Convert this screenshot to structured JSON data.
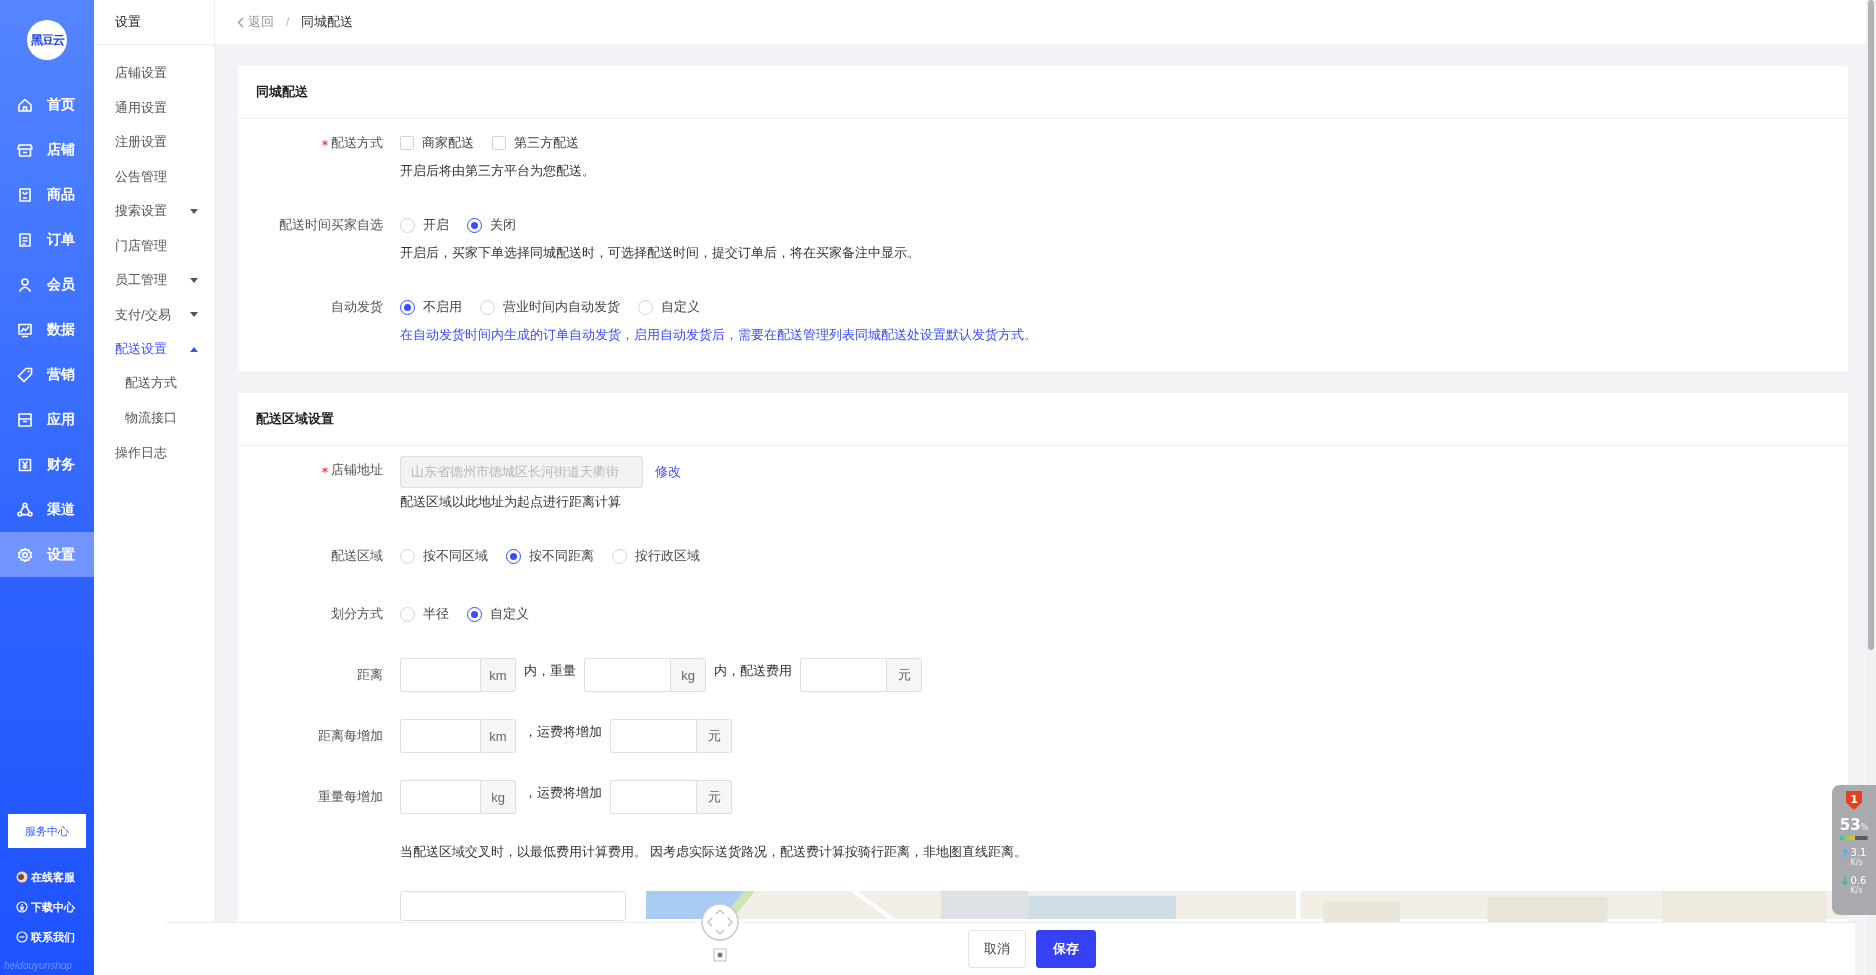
{
  "nav": {
    "logo": "黑豆云",
    "items": [
      {
        "label": "首页",
        "selected": false
      },
      {
        "label": "店铺",
        "selected": false
      },
      {
        "label": "商品",
        "selected": false
      },
      {
        "label": "订单",
        "selected": false
      },
      {
        "label": "会员",
        "selected": false
      },
      {
        "label": "数据",
        "selected": false
      },
      {
        "label": "营销",
        "selected": false
      },
      {
        "label": "应用",
        "selected": false
      },
      {
        "label": "财务",
        "selected": false
      },
      {
        "label": "渠道",
        "selected": false
      },
      {
        "label": "设置",
        "selected": true
      }
    ],
    "service_button": "服务中心",
    "links": [
      "在线客服",
      "下载中心",
      "联系我们"
    ],
    "footer": "heidouyunshop"
  },
  "subnav": {
    "title": "设置",
    "items": [
      {
        "kind": "link",
        "label": "店铺设置",
        "selected": false
      },
      {
        "kind": "link",
        "label": "通用设置",
        "selected": false
      },
      {
        "kind": "link",
        "label": "注册设置",
        "selected": false
      },
      {
        "kind": "link",
        "label": "公告管理",
        "selected": false
      },
      {
        "kind": "group",
        "label": "搜索设置",
        "selected": false,
        "expanded": false
      },
      {
        "kind": "link",
        "label": "门店管理",
        "selected": false
      },
      {
        "kind": "group",
        "label": "员工管理",
        "selected": false,
        "expanded": false
      },
      {
        "kind": "group",
        "label": "支付/交易",
        "selected": false,
        "expanded": false
      },
      {
        "kind": "group",
        "label": "配送设置",
        "selected": true,
        "expanded": true,
        "children": [
          {
            "label": "配送方式",
            "selected": false
          },
          {
            "label": "物流接口",
            "selected": false
          }
        ]
      },
      {
        "kind": "link",
        "label": "操作日志",
        "selected": false
      }
    ]
  },
  "breadcrumb": {
    "back": "返回",
    "separator": "/",
    "current": "同城配送"
  },
  "sections": [
    {
      "title": "同城配送",
      "fields": [
        {
          "kind": "checkboxes",
          "label": "配送方式",
          "required": true,
          "options": [
            {
              "label": "商家配送",
              "checked": false
            },
            {
              "label": "第三方配送",
              "checked": false
            }
          ],
          "hint": "开启后将由第三方平台为您配送。",
          "hint_accent": false
        },
        {
          "kind": "radios",
          "label": "配送时间买家自选",
          "required": false,
          "options": [
            {
              "label": "开启",
              "selected": false
            },
            {
              "label": "关闭",
              "selected": true
            }
          ],
          "hint": "开启后，买家下单选择同城配送时，可选择配送时间，提交订单后，将在买家备注中显示。",
          "hint_accent": false
        },
        {
          "kind": "radios",
          "label": "自动发货",
          "required": false,
          "options": [
            {
              "label": "不启用",
              "selected": true
            },
            {
              "label": "营业时间内自动发货",
              "selected": false
            },
            {
              "label": "自定义",
              "selected": false
            }
          ],
          "hint": "在自动发货时间内生成的订单自动发货，启用自动发货后，需要在配送管理列表同城配送处设置默认发货方式。",
          "hint_accent": true
        }
      ]
    },
    {
      "title": "配送区域设置",
      "fields": [
        {
          "kind": "address",
          "label": "店铺地址",
          "required": true,
          "value": "山东省德州市德城区长河街道天衢街",
          "disabled": true,
          "action": "修改",
          "hint": "配送区域以此地址为起点进行距离计算",
          "hint_accent": false
        },
        {
          "kind": "radios",
          "label": "配送区域",
          "required": false,
          "options": [
            {
              "label": "按不同区域",
              "selected": false
            },
            {
              "label": "按不同距离",
              "selected": true
            },
            {
              "label": "按行政区域",
              "selected": false
            }
          ]
        },
        {
          "kind": "radios",
          "label": "划分方式",
          "required": false,
          "options": [
            {
              "label": "半径",
              "selected": false
            },
            {
              "label": "自定义",
              "selected": true
            }
          ]
        },
        {
          "kind": "fee",
          "label": "距离",
          "required": false,
          "parts": [
            {
              "kind": "input",
              "unit": "km"
            },
            {
              "kind": "text",
              "text": "内，重量"
            },
            {
              "kind": "input",
              "unit": "kg"
            },
            {
              "kind": "text",
              "text": "内，配送费用"
            },
            {
              "kind": "input",
              "unit": "元"
            }
          ]
        },
        {
          "kind": "fee",
          "label": "距离每增加",
          "required": false,
          "parts": [
            {
              "kind": "input",
              "unit": "km"
            },
            {
              "kind": "text",
              "text": "，运费将增加"
            },
            {
              "kind": "input",
              "unit": "元"
            }
          ]
        },
        {
          "kind": "fee",
          "label": "重量每增加",
          "required": false,
          "parts": [
            {
              "kind": "input",
              "unit": "kg"
            },
            {
              "kind": "text",
              "text": "，运费将增加"
            },
            {
              "kind": "input",
              "unit": "元"
            }
          ]
        },
        {
          "kind": "note",
          "text": "当配送区域交叉时，以最低费用计算费用。 因考虑实际送货路况，配送费计算按骑行距离，非地图直线距离。"
        },
        {
          "kind": "map"
        }
      ]
    }
  ],
  "footer": {
    "buttons": [
      {
        "label": "取消",
        "kind": "default"
      },
      {
        "label": "保存",
        "kind": "primary"
      }
    ]
  },
  "monitor": {
    "badge": "1",
    "percent": "53",
    "percent_unit": "%",
    "level": 0.53,
    "upload": "3.1",
    "upload_unit": "K/s",
    "download": "0.6",
    "download_unit": "K/s"
  }
}
